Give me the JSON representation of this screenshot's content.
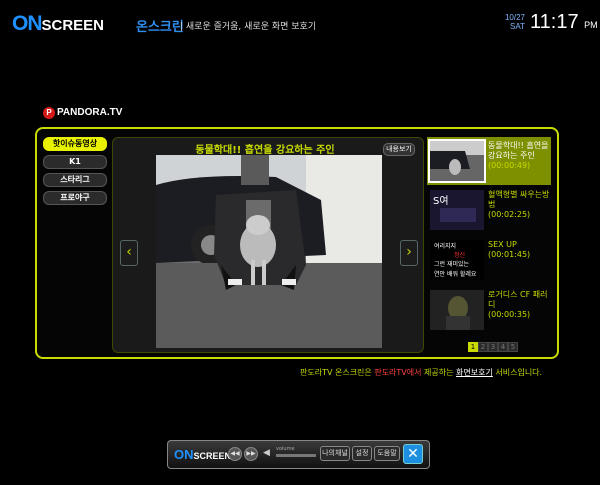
{
  "header": {
    "logo_on": "ON",
    "logo_screen": "SCREEN",
    "brand": "온스크린",
    "slogan": "| 새로운 즐거움, 새로운 화면 보호기",
    "date_md": "10/27",
    "date_day": "SAT",
    "time": "11:17",
    "ampm": "PM"
  },
  "provider": {
    "badge": "P",
    "name": "PANDORA.TV"
  },
  "categories": [
    "핫이슈동영상",
    "K1",
    "스타리그",
    "프로야구"
  ],
  "player": {
    "title": "동물학대!! 흡연을 강요하는 주인",
    "detail_button": "내용보기",
    "prev_arrow": "‹",
    "next_arrow": "›"
  },
  "videos": [
    {
      "title": "동물학대!! 흡연을 강요하는 주인",
      "duration": "(00:00:49)"
    },
    {
      "title": "혈액형별 싸우는방법",
      "duration": "(00:02:25)"
    },
    {
      "title": "SEX UP",
      "duration": "(00:01:45)"
    },
    {
      "title": "로거디스 CF 패러디",
      "duration": "(00:00:35)"
    }
  ],
  "thumb_texts": {
    "t2_label": "S여",
    "t3_lines": [
      "여리지지",
      "정신",
      "그런 재미있는",
      "연안 배워 할레요"
    ]
  },
  "pagination": [
    "1",
    "2",
    "3",
    "4",
    "5"
  ],
  "footer": {
    "part1": "판도라TV 온스크린은 ",
    "part2": "판도라TV에서",
    "part3": " 제공하는 ",
    "part4": "화면보호기",
    "part5": " 서비스입니다."
  },
  "bottom_bar": {
    "logo_on": "ON",
    "logo_screen": "SCREEN",
    "volume_label": "volume",
    "my_channel": "나의채널",
    "settings": "설정",
    "help": "도움말",
    "close": "✕"
  },
  "colors": {
    "accent": "#c8dc00",
    "brand_blue": "#1e90ff"
  }
}
